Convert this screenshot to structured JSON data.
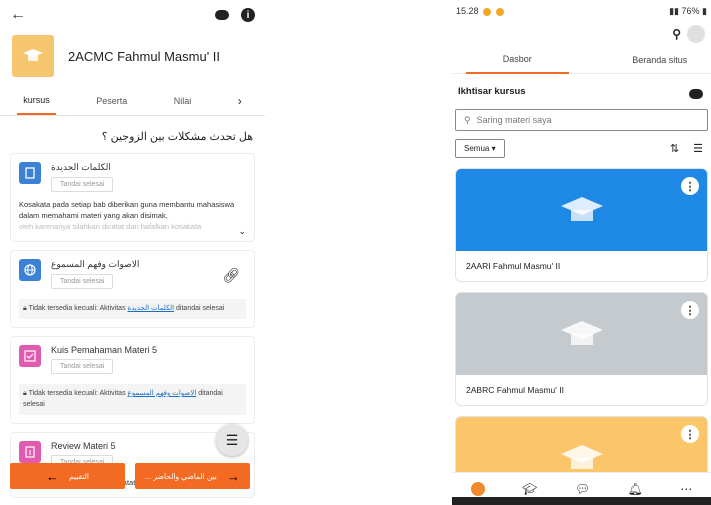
{
  "left": {
    "course_title": "2ACMC Fahmul Masmu' II",
    "tabs": [
      {
        "label": "kursus",
        "active": true
      },
      {
        "label": "Peserta",
        "active": false
      },
      {
        "label": "Nilai",
        "active": false
      }
    ],
    "section_title": "هل تحدث مشكلات بين الزوجين ؟",
    "activities": [
      {
        "title": "الكلمات الجديدة",
        "badge": "Tandai selesai",
        "text": "Kosakata pada setiap bab diberikan guna membantu mahasiswa dalam memahami materi yang akan disimak,",
        "text_fade": "oleh karenanya silahkan dicatat dan hafalkan kosakata",
        "color": "#3b82d6",
        "icon": "file-icon"
      },
      {
        "title": "الاصوات وفهم المسموع",
        "badge": "Tandai selesai",
        "restriction": "Tidak tersedia kecuali: Aktivitas",
        "restriction_link": "الكلمات الجديدة",
        "restriction_tail": "ditandai selesai",
        "color": "#3b82d6",
        "icon": "globe-icon"
      },
      {
        "title": "Kuis Pemahaman Materi 5",
        "badge": "Tandai selesai",
        "restriction": "Tidak tersedia kecuali: Aktivitas",
        "restriction_link": "الاصوات وفهم المسموع",
        "restriction_tail": "ditandai selesai",
        "color": "#e05bb0",
        "icon": "quiz-icon"
      },
      {
        "title": "Review Materi 5",
        "badge": "Tandai selesai",
        "text": "Setelah anda memahami mencatat, menghafal kosakata,",
        "color": "#e05bb0",
        "icon": "assignment-icon"
      }
    ],
    "prev_label": "التقييم",
    "next_label": "... بين الماضي والحاضر"
  },
  "right": {
    "status_time": "15.28",
    "status_battery": "76%",
    "tabs": [
      {
        "label": "Dasbor",
        "active": true
      },
      {
        "label": "Beranda situs",
        "active": false
      }
    ],
    "overview_title": "Ikhtisar kursus",
    "search_placeholder": "Saring materi saya",
    "filter_value": "Semua",
    "courses": [
      {
        "name": "2AARI Fahmul Masmu' II",
        "color": "#1e88e5"
      },
      {
        "name": "2ABRC Fahmul Masmu' II",
        "color": "#c5cacf"
      },
      {
        "name": "",
        "color": "#fbc66a"
      }
    ]
  }
}
